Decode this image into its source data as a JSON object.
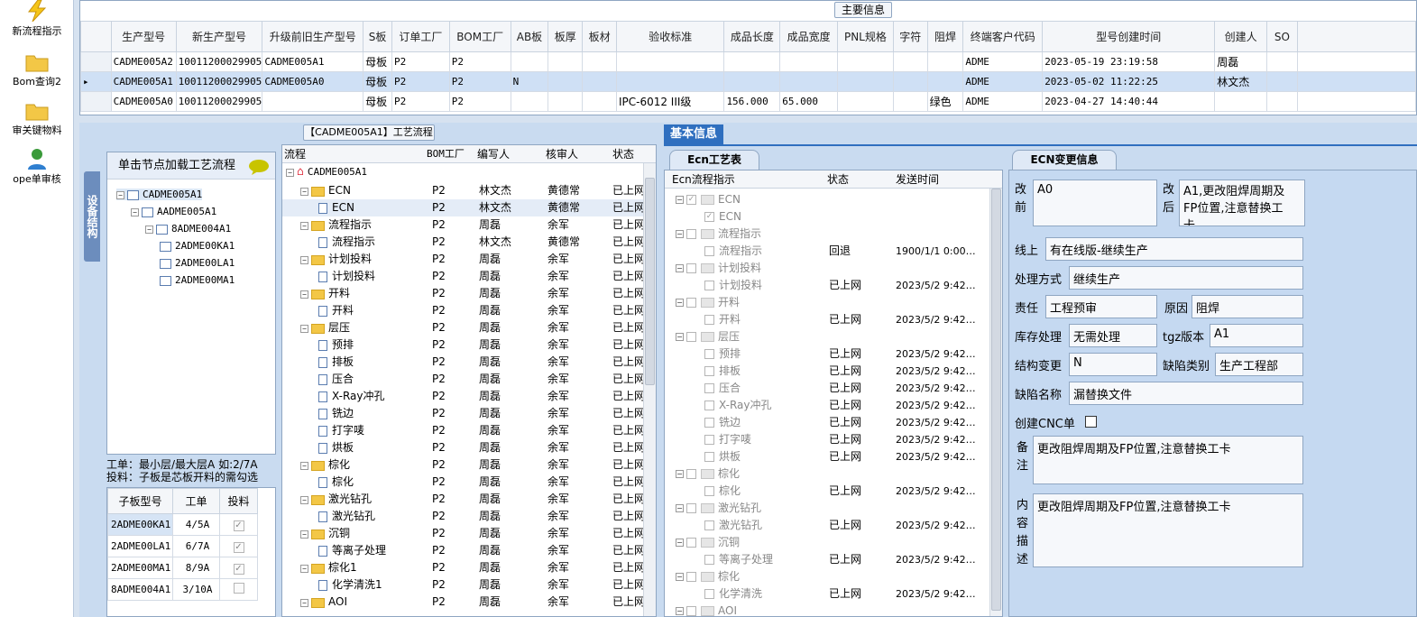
{
  "nav": {
    "items": [
      "新流程指示",
      "Bom查询2",
      "审关键物料",
      "ope单审核"
    ]
  },
  "top": {
    "title": "主要信息",
    "headers": [
      "生产型号",
      "新生产型号",
      "升级前旧生产型号",
      "S板",
      "订单工厂",
      "BOM工厂",
      "AB板",
      "板厚",
      "板材",
      "验收标准",
      "成品长度",
      "成品宽度",
      "PNL规格",
      "字符",
      "阻焊",
      "终端客户代码",
      "型号创建时间",
      "创建人",
      "SO"
    ],
    "rows": [
      [
        "CADME005A2",
        "10011200029905",
        "CADME005A1",
        "母板",
        "P2",
        "P2",
        "",
        "",
        "",
        "",
        "",
        "",
        "",
        "",
        "",
        "ADME",
        "2023-05-19 23:19:58",
        "周磊",
        ""
      ],
      [
        "CADME005A1",
        "10011200029905",
        "CADME005A0",
        "母板",
        "P2",
        "P2",
        "N",
        "",
        "",
        "",
        "",
        "",
        "",
        "",
        "",
        "ADME",
        "2023-05-02 11:22:25",
        "林文杰",
        ""
      ],
      [
        "CADME005A0",
        "10011200029905",
        "",
        "母板",
        "P2",
        "P2",
        "",
        "",
        "",
        "IPC-6012 III级",
        "156.000",
        "65.000",
        "",
        "",
        "绿色",
        "ADME",
        "2023-04-27 14:40:44",
        "",
        ""
      ]
    ]
  },
  "struct": {
    "tab": "设备结构",
    "hint": "单击节点加载工艺流程",
    "nodes": [
      "CADME005A1",
      "AADME005A1",
      "8ADME004A1",
      "2ADME00KA1",
      "2ADME00LA1",
      "2ADME00MA1"
    ],
    "note1": "工单：最小层/最大层A 如:2/7A",
    "note2": "投料：子板是芯板开料的需勾选",
    "sub_headers": [
      "子板型号",
      "工单",
      "投料"
    ],
    "sub_rows": [
      [
        "2ADME00KA1",
        "4/5A"
      ],
      [
        "2ADME00LA1",
        "6/7A"
      ],
      [
        "2ADME00MA1",
        "8/9A"
      ],
      [
        "8ADME004A1",
        "3/10A"
      ]
    ]
  },
  "flow": {
    "title": "【CADME005A1】工艺流程",
    "headers": [
      "流程",
      "BOM工厂",
      "编写人",
      "核审人",
      "状态"
    ],
    "root": "CADME005A1",
    "rows": [
      {
        "n": "ECN",
        "lvl": 1,
        "f": "P2",
        "w": "林文杰",
        "r": "黄德常",
        "s": "已上网"
      },
      {
        "n": "ECN",
        "lvl": 2,
        "f": "P2",
        "w": "林文杰",
        "r": "黄德常",
        "s": "已上网"
      },
      {
        "n": "流程指示",
        "lvl": 1,
        "f": "P2",
        "w": "周磊",
        "r": "余军",
        "s": "已上网"
      },
      {
        "n": "流程指示",
        "lvl": 2,
        "f": "P2",
        "w": "林文杰",
        "r": "黄德常",
        "s": "已上网"
      },
      {
        "n": "计划投料",
        "lvl": 1,
        "f": "P2",
        "w": "周磊",
        "r": "余军",
        "s": "已上网"
      },
      {
        "n": "计划投料",
        "lvl": 2,
        "f": "P2",
        "w": "周磊",
        "r": "余军",
        "s": "已上网"
      },
      {
        "n": "开料",
        "lvl": 1,
        "f": "P2",
        "w": "周磊",
        "r": "余军",
        "s": "已上网"
      },
      {
        "n": "开料",
        "lvl": 2,
        "f": "P2",
        "w": "周磊",
        "r": "余军",
        "s": "已上网"
      },
      {
        "n": "层压",
        "lvl": 1,
        "f": "P2",
        "w": "周磊",
        "r": "余军",
        "s": "已上网"
      },
      {
        "n": "预排",
        "lvl": 2,
        "f": "P2",
        "w": "周磊",
        "r": "余军",
        "s": "已上网"
      },
      {
        "n": "排板",
        "lvl": 2,
        "f": "P2",
        "w": "周磊",
        "r": "余军",
        "s": "已上网"
      },
      {
        "n": "压合",
        "lvl": 2,
        "f": "P2",
        "w": "周磊",
        "r": "余军",
        "s": "已上网"
      },
      {
        "n": "X-Ray冲孔",
        "lvl": 2,
        "f": "P2",
        "w": "周磊",
        "r": "余军",
        "s": "已上网"
      },
      {
        "n": "铣边",
        "lvl": 2,
        "f": "P2",
        "w": "周磊",
        "r": "余军",
        "s": "已上网"
      },
      {
        "n": "打字唛",
        "lvl": 2,
        "f": "P2",
        "w": "周磊",
        "r": "余军",
        "s": "已上网"
      },
      {
        "n": "烘板",
        "lvl": 2,
        "f": "P2",
        "w": "周磊",
        "r": "余军",
        "s": "已上网"
      },
      {
        "n": "棕化",
        "lvl": 1,
        "f": "P2",
        "w": "周磊",
        "r": "余军",
        "s": "已上网"
      },
      {
        "n": "棕化",
        "lvl": 2,
        "f": "P2",
        "w": "周磊",
        "r": "余军",
        "s": "已上网"
      },
      {
        "n": "激光钻孔",
        "lvl": 1,
        "f": "P2",
        "w": "周磊",
        "r": "余军",
        "s": "已上网"
      },
      {
        "n": "激光钻孔",
        "lvl": 2,
        "f": "P2",
        "w": "周磊",
        "r": "余军",
        "s": "已上网"
      },
      {
        "n": "沉铜",
        "lvl": 1,
        "f": "P2",
        "w": "周磊",
        "r": "余军",
        "s": "已上网"
      },
      {
        "n": "等离子处理",
        "lvl": 2,
        "f": "P2",
        "w": "周磊",
        "r": "余军",
        "s": "已上网"
      },
      {
        "n": "棕化1",
        "lvl": 1,
        "f": "P2",
        "w": "周磊",
        "r": "余军",
        "s": "已上网"
      },
      {
        "n": "化学清洗1",
        "lvl": 2,
        "f": "P2",
        "w": "周磊",
        "r": "余军",
        "s": "已上网"
      },
      {
        "n": "AOI",
        "lvl": 1,
        "f": "P2",
        "w": "周磊",
        "r": "余军",
        "s": "已上网"
      }
    ]
  },
  "basic": {
    "tab": "基本信息",
    "ecn_tab": "Ecn工艺表",
    "headers": [
      "Ecn流程指示",
      "状态",
      "发送时间"
    ],
    "rows": [
      {
        "n": "ECN",
        "lvl": 1,
        "s": "",
        "t": ""
      },
      {
        "n": "ECN",
        "lvl": 2,
        "s": "",
        "t": ""
      },
      {
        "n": "流程指示",
        "lvl": 1,
        "s": "",
        "t": ""
      },
      {
        "n": "流程指示",
        "lvl": 2,
        "s": "回退",
        "t": "1900/1/1 0:00…"
      },
      {
        "n": "计划投料",
        "lvl": 1,
        "s": "",
        "t": ""
      },
      {
        "n": "计划投料",
        "lvl": 2,
        "s": "已上网",
        "t": "2023/5/2 9:42…"
      },
      {
        "n": "开料",
        "lvl": 1,
        "s": "",
        "t": ""
      },
      {
        "n": "开料",
        "lvl": 2,
        "s": "已上网",
        "t": "2023/5/2 9:42…"
      },
      {
        "n": "层压",
        "lvl": 1,
        "s": "",
        "t": ""
      },
      {
        "n": "预排",
        "lvl": 2,
        "s": "已上网",
        "t": "2023/5/2 9:42…"
      },
      {
        "n": "排板",
        "lvl": 2,
        "s": "已上网",
        "t": "2023/5/2 9:42…"
      },
      {
        "n": "压合",
        "lvl": 2,
        "s": "已上网",
        "t": "2023/5/2 9:42…"
      },
      {
        "n": "X-Ray冲孔",
        "lvl": 2,
        "s": "已上网",
        "t": "2023/5/2 9:42…"
      },
      {
        "n": "铣边",
        "lvl": 2,
        "s": "已上网",
        "t": "2023/5/2 9:42…"
      },
      {
        "n": "打字唛",
        "lvl": 2,
        "s": "已上网",
        "t": "2023/5/2 9:42…"
      },
      {
        "n": "烘板",
        "lvl": 2,
        "s": "已上网",
        "t": "2023/5/2 9:42…"
      },
      {
        "n": "棕化",
        "lvl": 1,
        "s": "",
        "t": ""
      },
      {
        "n": "棕化",
        "lvl": 2,
        "s": "已上网",
        "t": "2023/5/2 9:42…"
      },
      {
        "n": "激光钻孔",
        "lvl": 1,
        "s": "",
        "t": ""
      },
      {
        "n": "激光钻孔",
        "lvl": 2,
        "s": "已上网",
        "t": "2023/5/2 9:42…"
      },
      {
        "n": "沉铜",
        "lvl": 1,
        "s": "",
        "t": ""
      },
      {
        "n": "等离子处理",
        "lvl": 2,
        "s": "已上网",
        "t": "2023/5/2 9:42…"
      },
      {
        "n": "棕化",
        "lvl": 1,
        "s": "",
        "t": ""
      },
      {
        "n": "化学清洗",
        "lvl": 2,
        "s": "已上网",
        "t": "2023/5/2 9:42…"
      },
      {
        "n": "AOI",
        "lvl": 1,
        "s": "",
        "t": ""
      }
    ]
  },
  "ecn": {
    "tab": "ECN变更信息",
    "before_label": "改前",
    "before": "A0",
    "after_label": "改后",
    "after": "A1,更改阻焊周期及FP位置,注意替换工卡",
    "online_label": "线上",
    "online": "有在线版-继续生产",
    "method_label": "处理方式",
    "method": "继续生产",
    "resp_label": "责任",
    "resp": "工程预审",
    "reason_label": "原因",
    "reason": "阻焊",
    "stock_label": "库存处理",
    "stock": "无需处理",
    "tgz_label": "tgz版本",
    "tgz": "A1",
    "struct_label": "结构变更",
    "struct": "N",
    "defect_type_label": "缺陷类别",
    "defect_type": "生产工程部",
    "defect_name_label": "缺陷名称",
    "defect_name": "漏替换文件",
    "cnc_label": "创建CNC单",
    "remark_label": "备注",
    "remark": "更改阻焊周期及FP位置,注意替换工卡",
    "content_label": "内容描述",
    "content": "更改阻焊周期及FP位置,注意替换工卡"
  }
}
